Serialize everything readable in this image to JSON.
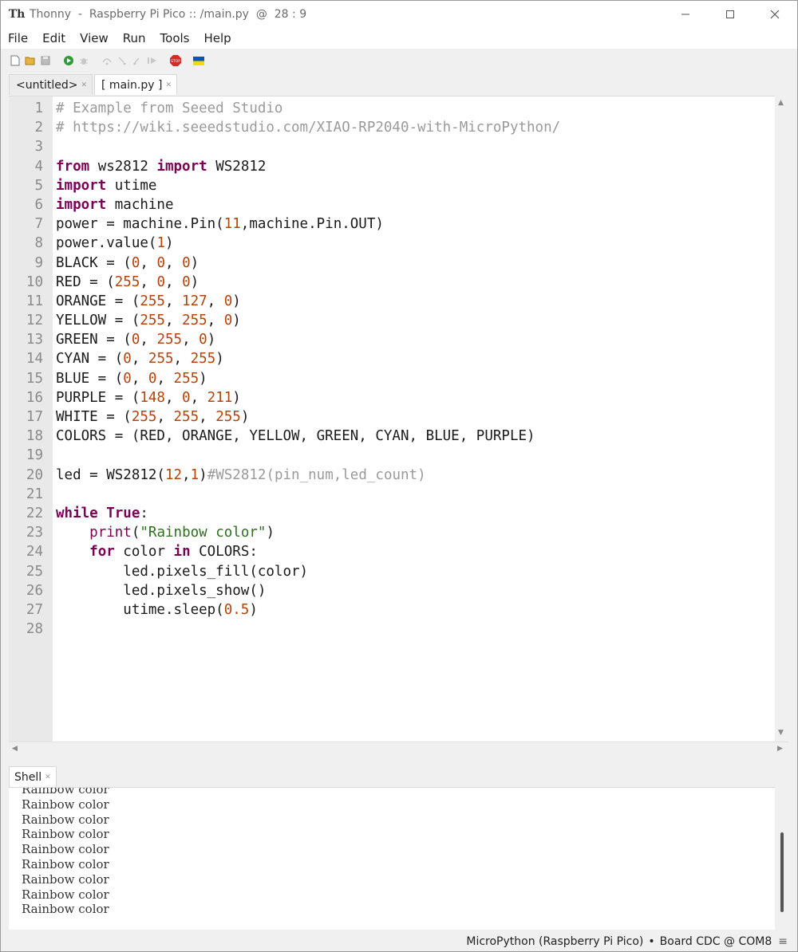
{
  "window": {
    "title": "Thonny  -  Raspberry Pi Pico :: /main.py  @  28 : 9",
    "app_icon_text": "Th",
    "controls": [
      "minimize-icon",
      "maximize-icon",
      "close-icon"
    ]
  },
  "menu": [
    "File",
    "Edit",
    "View",
    "Run",
    "Tools",
    "Help"
  ],
  "toolbar": {
    "icons": [
      "new-file-icon",
      "open-file-icon",
      "save-icon",
      "run-icon",
      "debug-icon",
      "step-over-icon",
      "step-into-icon",
      "step-out-icon",
      "resume-icon",
      "stop-icon",
      "ukraine-flag-icon"
    ],
    "stop_label": "STOP",
    "accent_run": "#2e9d33",
    "accent_stop": "#d62a2a"
  },
  "tabs": [
    {
      "label": "<untitled>",
      "active": false
    },
    {
      "label": "[ main.py ]",
      "active": true
    }
  ],
  "editor": {
    "lines": [
      "# Example from Seeed Studio",
      "# https://wiki.seeedstudio.com/XIAO-RP2040-with-MicroPython/",
      "",
      "from ws2812 import WS2812",
      "import utime",
      "import machine",
      "power = machine.Pin(11,machine.Pin.OUT)",
      "power.value(1)",
      "BLACK = (0, 0, 0)",
      "RED = (255, 0, 0)",
      "ORANGE = (255, 127, 0)",
      "YELLOW = (255, 255, 0)",
      "GREEN = (0, 255, 0)",
      "CYAN = (0, 255, 255)",
      "BLUE = (0, 0, 255)",
      "PURPLE = (148, 0, 211)",
      "WHITE = (255, 255, 255)",
      "COLORS = (RED, ORANGE, YELLOW, GREEN, CYAN, BLUE, PURPLE)",
      "",
      "led = WS2812(12,1)#WS2812(pin_num,led_count)",
      "",
      "while True:",
      "    print(\"Rainbow color\")",
      "    for color in COLORS:",
      "        led.pixels_fill(color)",
      "        led.pixels_show()",
      "        utime.sleep(0.5)",
      ""
    ],
    "cursor_line": 28
  },
  "shell": {
    "tab_label": "Shell",
    "lines": [
      "Rainbow color",
      "Rainbow color",
      "Rainbow color",
      "Rainbow color",
      "Rainbow color",
      "Rainbow color",
      "Rainbow color",
      "Rainbow color",
      "Rainbow color"
    ]
  },
  "status": {
    "interpreter": "MicroPython (Raspberry Pi Pico)",
    "separator": "•",
    "port": "Board CDC @ COM8",
    "menu_icon": "hamburger-icon"
  }
}
